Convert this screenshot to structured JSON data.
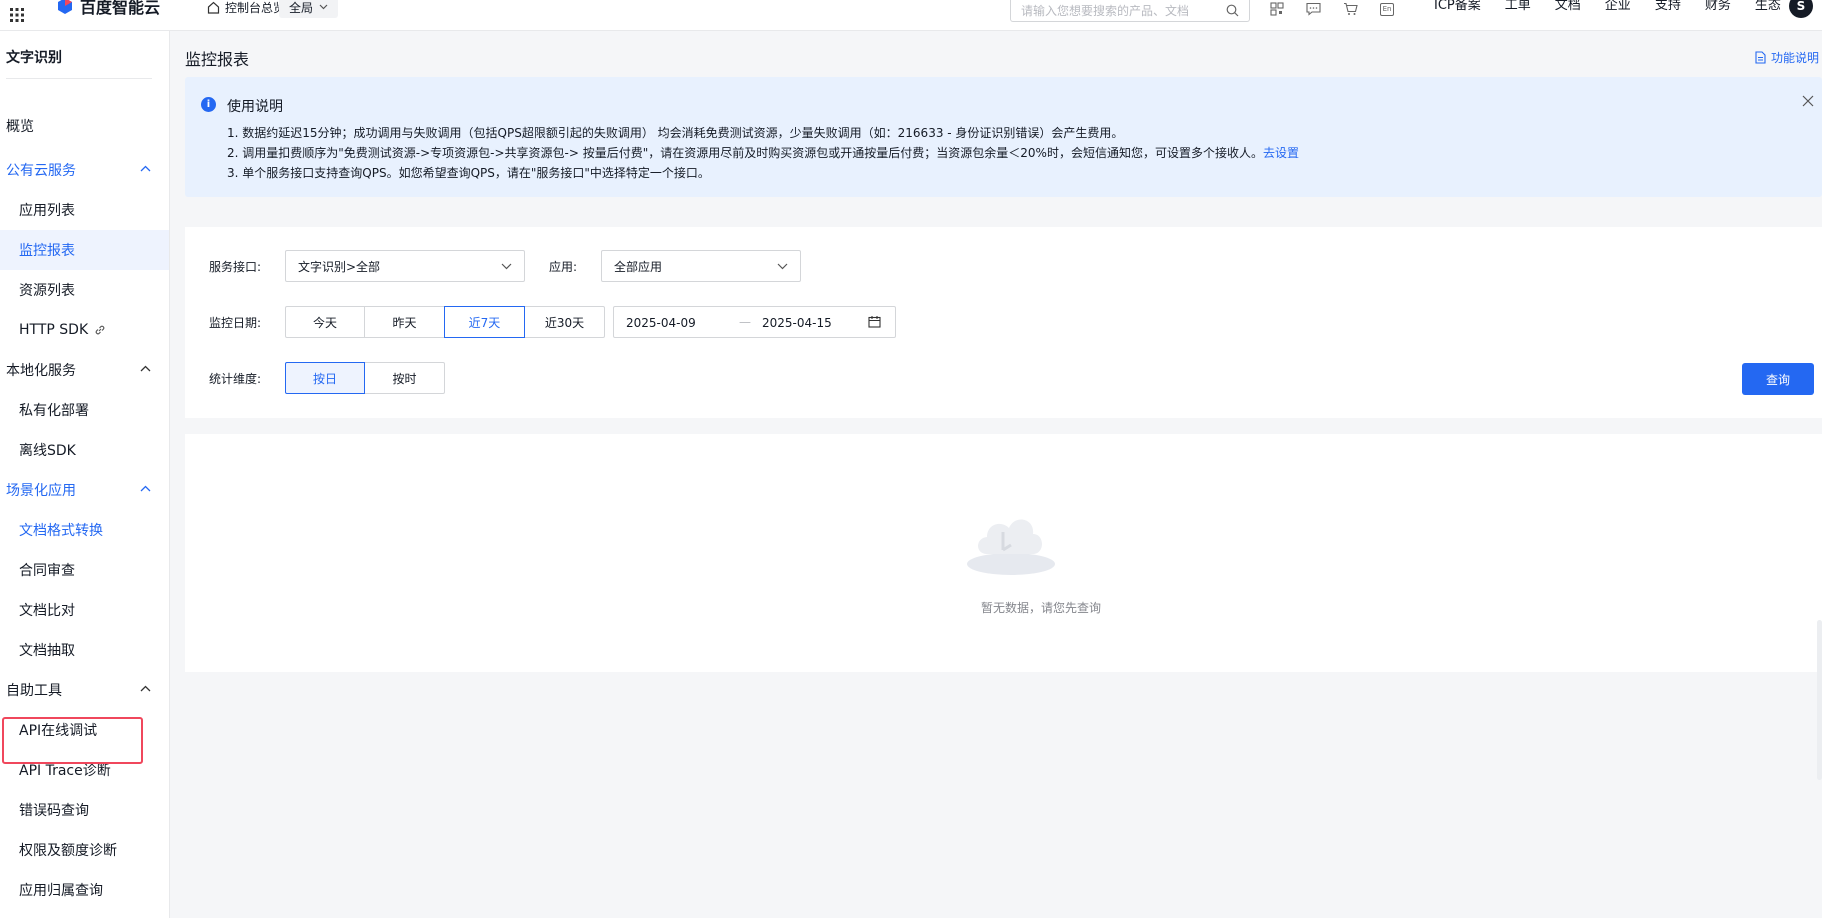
{
  "topbar": {
    "brand": "百度智能云",
    "console_home": "控制台总览",
    "scope": "全局",
    "search_placeholder": "请输入您想要搜索的产品、文档",
    "icons": [
      "grid-icon",
      "qrcode-icon",
      "message-icon",
      "cart-icon",
      "language-icon"
    ],
    "lang_label": "En",
    "menu": [
      "ICP备案",
      "工单",
      "文档",
      "企业",
      "支持",
      "财务",
      "生态"
    ],
    "avatar": "S"
  },
  "sidebar": {
    "title": "文字识别",
    "items": [
      {
        "label": "概览"
      },
      {
        "label": "公有云服务"
      },
      {
        "label": "应用列表"
      },
      {
        "label": "监控报表"
      },
      {
        "label": "资源列表"
      },
      {
        "label": "HTTP SDK"
      },
      {
        "label": "本地化服务"
      },
      {
        "label": "私有化部署"
      },
      {
        "label": "离线SDK"
      },
      {
        "label": "场景化应用"
      },
      {
        "label": "文档格式转换"
      },
      {
        "label": "合同审查"
      },
      {
        "label": "文档比对"
      },
      {
        "label": "文档抽取"
      },
      {
        "label": "自助工具"
      },
      {
        "label": "API在线调试"
      },
      {
        "label": "API Trace诊断"
      },
      {
        "label": "错误码查询"
      },
      {
        "label": "权限及额度诊断"
      },
      {
        "label": "应用归属查询"
      }
    ],
    "highlight_color": "#f0475c"
  },
  "main": {
    "title": "监控报表",
    "help_link": "功能说明",
    "notice": {
      "title": "使用说明",
      "line1": "1. 数据约延迟15分钟；成功调用与失败调用（包括QPS超限额引起的失败调用） 均会消耗免费测试资源，少量失败调用（如：216633 - 身份证识别错误）会产生费用。",
      "line2": "2. 调用量扣费顺序为\"免费测试资源->专项资源包->共享资源包-> 按量后付费\"，请在资源用尽前及时购买资源包或开通按量后付费；当资源包余量＜20%时，会短信通知您，可设置多个接收人。",
      "line2_link": "去设置",
      "line3": "3. 单个服务接口支持查询QPS。如您希望查询QPS，请在\"服务接口\"中选择特定一个接口。"
    },
    "filters": {
      "service_label": "服务接口:",
      "service_value": "文字识别>全部",
      "app_label": "应用:",
      "app_value": "全部应用",
      "date_label": "监控日期:",
      "date_options": [
        "今天",
        "昨天",
        "近7天",
        "近30天"
      ],
      "date_selected": "近7天",
      "date_start": "2025-04-09",
      "date_sep": "—",
      "date_end": "2025-04-15",
      "dimension_label": "统计维度:",
      "dimension_options": [
        "按日",
        "按时"
      ],
      "dimension_selected": "按日",
      "query_button": "查询"
    },
    "empty": {
      "text": "暂无数据，请您先查询"
    }
  },
  "colors": {
    "accent": "#2468f2",
    "notice_bg": "#e8f1fe",
    "highlight": "#f0475c"
  }
}
